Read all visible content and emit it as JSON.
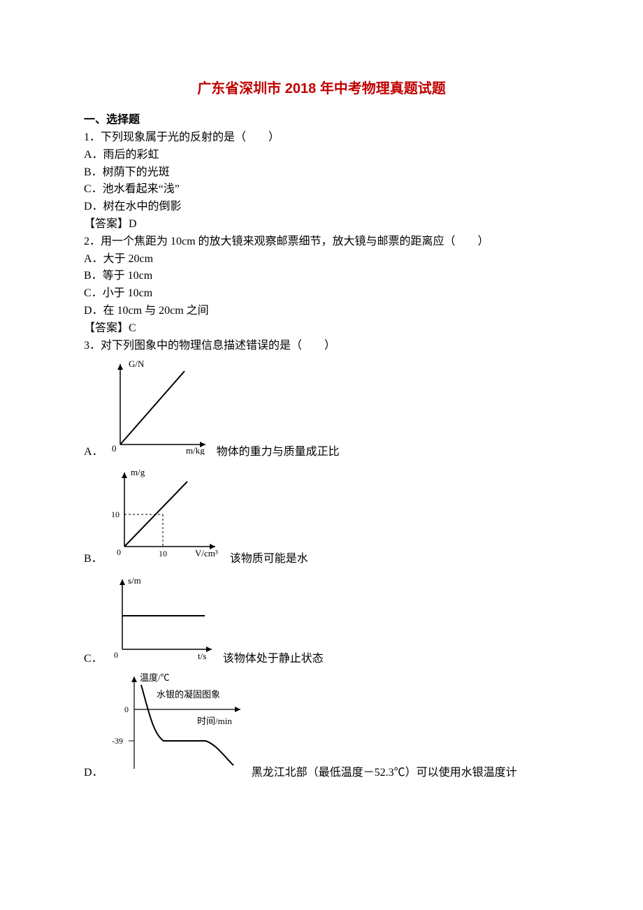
{
  "title": "广东省深圳市 2018 年中考物理真题试题",
  "section_heading": "一、选择题",
  "q1": {
    "stem": "1．下列现象属于光的反射的是（　　）",
    "A": "A．雨后的彩虹",
    "B": "B．树荫下的光斑",
    "C": "C．池水看起来“浅”",
    "D": "D．树在水中的倒影",
    "ans": "【答案】D"
  },
  "q2": {
    "stem": "2．用一个焦距为 10cm 的放大镜来观察邮票细节，放大镜与邮票的距离应（　　）",
    "A": "A．大于 20cm",
    "B": "B．等于 10cm",
    "C": "C．小于 10cm",
    "D": "D．在 10cm 与 20cm 之间",
    "ans": "【答案】C"
  },
  "q3": {
    "stem": "3．对下列图象中的物理信息描述错误的是（　　）",
    "A_label": "A．",
    "A_text": "物体的重力与质量成正比",
    "B_label": "B．",
    "B_text": "该物质可能是水",
    "C_label": "C．",
    "C_text": "该物体处于静止状态",
    "D_label": "D．",
    "D_text": "黑龙江北部（最低温度－52.3℃）可以使用水银温度计"
  },
  "chart_data": [
    {
      "type": "line",
      "option": "A",
      "xlabel": "m/kg",
      "ylabel": "G/N",
      "series": [
        {
          "name": "line",
          "x": [
            0,
            1
          ],
          "y": [
            0,
            1
          ]
        }
      ],
      "note": "linear through origin"
    },
    {
      "type": "line",
      "option": "B",
      "xlabel": "V/cm³",
      "ylabel": "m/g",
      "series": [
        {
          "name": "line",
          "x": [
            0,
            10
          ],
          "y": [
            0,
            10
          ]
        }
      ],
      "xticks": [
        0,
        10
      ],
      "yticks": [
        0,
        10
      ],
      "note": "linear through origin; dashed guides at 10"
    },
    {
      "type": "line",
      "option": "C",
      "xlabel": "t/s",
      "ylabel": "s/m",
      "series": [
        {
          "name": "line",
          "x": [
            0,
            1
          ],
          "y": [
            0.4,
            0.4
          ]
        }
      ],
      "note": "horizontal nonzero line (constant nonzero displacement)"
    },
    {
      "type": "line",
      "option": "D",
      "xlabel": "时间/min",
      "ylabel": "温度/℃",
      "title": "水银的凝固图象",
      "yticks": [
        0,
        -39
      ],
      "series": [
        {
          "name": "curve",
          "segments": [
            "cooling",
            "plateau at -39",
            "cooling"
          ]
        }
      ]
    }
  ]
}
